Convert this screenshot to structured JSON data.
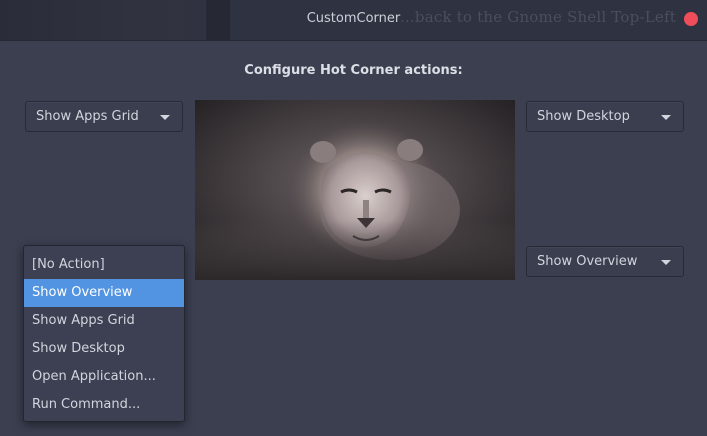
{
  "window": {
    "title": "CustomCorner",
    "background_text": "...back to the Gnome Shell Top-Left"
  },
  "heading": "Configure Hot Corner actions:",
  "corners": {
    "top_left": "Show Apps Grid",
    "top_right": "Show Desktop",
    "bottom_right": "Show Overview"
  },
  "dropdown": {
    "options": [
      {
        "label": "[No Action]"
      },
      {
        "label": "Show Overview"
      },
      {
        "label": "Show Apps Grid"
      },
      {
        "label": "Show Desktop"
      },
      {
        "label": "Open Application..."
      },
      {
        "label": "Run Command..."
      }
    ],
    "selected_label": "Show Overview"
  },
  "preview": {
    "icon": "lion-wallpaper-image"
  },
  "colors": {
    "accent": "#5294e2",
    "close": "#f04d5a",
    "window_bg": "#3b3f50",
    "titlebar_bg": "#2f3240"
  }
}
